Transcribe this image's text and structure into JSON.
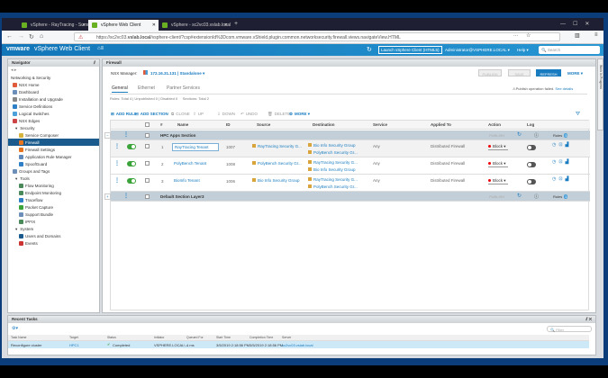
{
  "browser": {
    "tabs": [
      {
        "label": "vSphere - RayTracing - Summ"
      },
      {
        "label": "vSphere Web Client",
        "active": true
      },
      {
        "label": "vSphere - sc2vc03.vslab.local"
      }
    ],
    "url_prefix": "https://sc2vc03.",
    "url_host": "vslab.local",
    "url_rest": "/vsphere-client/?csp#extensionId%3Dcom.vmware.vShield.plugin.common.networksecurity.firewall.views.navigateView.HTML",
    "new_tab": "+",
    "menu_more": "···"
  },
  "header": {
    "brand": "vmware",
    "product": "vSphere Web Client",
    "launch": "Launch vSphere Client (HTML5)",
    "user": "Administrator@VSPHERE.LOCAL ▾",
    "help": "Help ▾",
    "search_placeholder": "Search"
  },
  "navigator": {
    "title": "Navigator",
    "root": "Networking & Security",
    "items": [
      {
        "label": "NSX Home",
        "color": "#e05b3a",
        "indent": 1
      },
      {
        "label": "Dashboard",
        "color": "#6b8fb8",
        "indent": 1
      },
      {
        "label": "Installation and Upgrade",
        "color": "#888",
        "indent": 1
      },
      {
        "label": "Service Definitions",
        "color": "#2f7fc6",
        "indent": 1
      },
      {
        "label": "Logical Switches",
        "color": "#4aa0d8",
        "indent": 1
      },
      {
        "label": "NSX Edges",
        "color": "#c44",
        "indent": 1
      },
      {
        "label": "Security",
        "group": true
      },
      {
        "label": "Service Composer",
        "color": "#d7b43c",
        "indent": 2
      },
      {
        "label": "Firewall",
        "color": "#e8741e",
        "indent": 2,
        "selected": true
      },
      {
        "label": "Firewall Settings",
        "color": "#e8741e",
        "indent": 2
      },
      {
        "label": "Application Rule Manager",
        "color": "#5f89b8",
        "indent": 2
      },
      {
        "label": "SpoofGuard",
        "color": "#2f7fc6",
        "indent": 2
      },
      {
        "label": "Groups and Tags",
        "color": "#6b8fb8",
        "indent": 1
      },
      {
        "label": "Tools",
        "group": true
      },
      {
        "label": "Flow Monitoring",
        "color": "#4a8a5a",
        "indent": 2
      },
      {
        "label": "Endpoint Monitoring",
        "color": "#4a8a5a",
        "indent": 2
      },
      {
        "label": "Traceflow",
        "color": "#2f7fc6",
        "indent": 2
      },
      {
        "label": "Packet Capture",
        "color": "#3aa33a",
        "indent": 2
      },
      {
        "label": "Support Bundle",
        "color": "#6b8fb8",
        "indent": 2
      },
      {
        "label": "IPFIX",
        "color": "#4a8a5a",
        "indent": 2
      },
      {
        "label": "System",
        "group": true
      },
      {
        "label": "Users and Domains",
        "color": "#1b5a8c",
        "indent": 2
      },
      {
        "label": "Events",
        "color": "#c33",
        "indent": 2
      }
    ]
  },
  "firewall": {
    "title": "Firewall",
    "nsx_label": "NSX Manager:",
    "nsx_value": "172.16.31.131 | Standalone ▾",
    "buttons": {
      "publish": "PUBLISH",
      "save": "SAVE",
      "refresh": "REFRESH",
      "more": "MORE ▾"
    },
    "tabs": [
      "General",
      "Ethernet",
      "Partner Services"
    ],
    "summary": "Rules: Total 4 | Unpublished 0 | Disabled 0     Sections: Total 2",
    "publish_failed": "Publish operation failed.",
    "see_details": "See details",
    "toolbar": [
      "ADD RULE",
      "ADD SECTION",
      "CLONE",
      "UP",
      "DOWN",
      "UNDO",
      "DELETE",
      "MORE ▾"
    ],
    "columns": [
      "#",
      "Name",
      "ID",
      "Source",
      "Destination",
      "Service",
      "Applied To",
      "Action",
      "Log"
    ],
    "sections": [
      {
        "name": "HPC Apps Section",
        "publish": "PUBLISH",
        "rules_label": "Rules",
        "rules_count": "3"
      },
      {
        "name": "Default Section Layer3",
        "publish": "PUBLISH",
        "rules_label": "Rules",
        "rules_count": "1"
      }
    ],
    "rules": [
      {
        "num": "1",
        "name": "RayTracing Tenant",
        "id": "1007",
        "source": [
          "RayTracing Security G..."
        ],
        "destination": [
          "Bio Info Security Group",
          "PolyBench Security Gr..."
        ],
        "service": "Any",
        "applied_to": "Distributed Firewall",
        "action": "Block ▾",
        "enabled": true,
        "log": false
      },
      {
        "num": "2",
        "name": "PolyBench Tenant",
        "id": "1008",
        "source": [
          "PolyBench Security Gr..."
        ],
        "destination": [
          "RayTracing Security G...",
          "Bio Info Security Group"
        ],
        "service": "Any",
        "applied_to": "Distributed Firewall",
        "action": "Block ▾",
        "enabled": true,
        "log": false
      },
      {
        "num": "3",
        "name": "BioInfo Tenant",
        "id": "1006",
        "source": [
          "Bio Info Security Group"
        ],
        "destination": [
          "RayTracing Security G...",
          "PolyBench Security Gr..."
        ],
        "service": "Any",
        "applied_to": "Distributed Firewall",
        "action": "Block ▾",
        "enabled": true,
        "log": false
      }
    ]
  },
  "side_strip": "Work In Progress",
  "tasks": {
    "title": "Recent Tasks",
    "filter_placeholder": "Filter",
    "columns": [
      "Task Name",
      "Target",
      "Status",
      "Initiator",
      "Queued For",
      "Start Time",
      "Completion Time",
      "Server"
    ],
    "rows": [
      {
        "task": "Reconfigure cluster",
        "target": "HPC1",
        "status": "Completed",
        "initiator": "VSPHERE.LOCAL\\...",
        "queued": "4 ms",
        "start": "3/5/2019 2:18:56 PM",
        "completion": "3/5/2019 2:18:56 PM",
        "server": "sc2vc03.vslab.local"
      }
    ]
  },
  "colors": {
    "accent": "#1a7cc0",
    "header": "#1e88c9",
    "selected": "#1b5a8c",
    "toggle_on": "#3aa33a",
    "block": "#e00000"
  }
}
